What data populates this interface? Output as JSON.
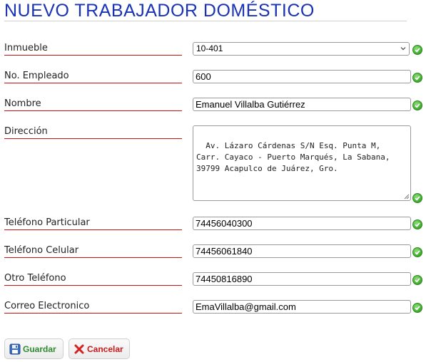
{
  "page": {
    "title": "NUEVO TRABAJADOR DOMÉSTICO"
  },
  "form": {
    "inmueble": {
      "label": "Inmueble",
      "value": "10-401"
    },
    "empleado": {
      "label": "No. Empleado",
      "value": "600"
    },
    "nombre": {
      "label": "Nombre",
      "value": "Emanuel Villalba Gutiérrez"
    },
    "direccion": {
      "label": "Dirección",
      "value": "Av. Lázaro Cárdenas S/N Esq. Punta M, Carr. Cayaco - Puerto Marqués, La Sabana, 39799 Acapulco de Juárez, Gro."
    },
    "tel_particular": {
      "label": "Teléfono Particular",
      "value": "74456040300"
    },
    "tel_celular": {
      "label": "Teléfono Celular",
      "value": "74456061840"
    },
    "otro_tel": {
      "label": "Otro Teléfono",
      "value": "74450816890"
    },
    "correo": {
      "label": "Correo Electronico",
      "value": "EmaVillalba@gmail.com"
    }
  },
  "actions": {
    "save_label": "Guardar",
    "cancel_label": "Cancelar"
  },
  "icons": {
    "valid": "check-circle-icon",
    "save": "floppy-disk-icon",
    "cancel": "red-x-icon",
    "dropdown": "chevron-down-icon"
  },
  "colors": {
    "title": "#1a32b4",
    "label_rule": "#cc1111",
    "valid": "#3ea82a",
    "save_text": "#2e8a2e",
    "cancel_text": "#c81b1b"
  }
}
